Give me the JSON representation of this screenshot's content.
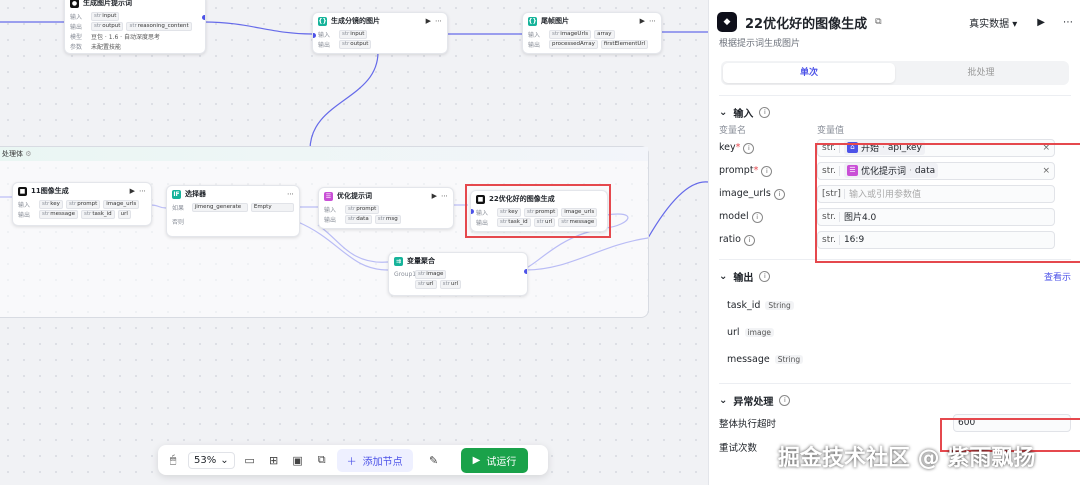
{
  "canvas": {
    "top_node_left": {
      "title": "生成图片提示词",
      "input_label": "输入",
      "output_label": "输出",
      "model_label": "模型",
      "param_label": "参数",
      "input_tag": "input",
      "output_tags": [
        "output",
        "reasoning_content"
      ],
      "model_value": "豆包 · 1.6 · 自动深度思考",
      "param_value": "未配置技能"
    },
    "node_split": {
      "title": "生成分镜的图片",
      "input_label": "输入",
      "output_label": "输出",
      "input_tag": "input",
      "output_tag": "output"
    },
    "node_tail": {
      "title": "尾帧图片",
      "input_label": "输入",
      "output_label": "输出",
      "input_tags": [
        "imageUrls",
        "array"
      ],
      "output_tags": [
        "processedArray",
        "firstElementUrl"
      ]
    },
    "group_title": "处理体",
    "node_11": {
      "title": "11图像生成",
      "input_label": "输入",
      "output_label": "输出",
      "input_tags": [
        "key",
        "prompt",
        "image_urls"
      ],
      "output_tags": [
        "message",
        "task_id",
        "url"
      ]
    },
    "node_selector": {
      "title": "选择器",
      "if_label": "如果",
      "else_label": "否则",
      "condition_value": "jimeng_generate",
      "condition_op": "Empty"
    },
    "node_optimize": {
      "title": "优化提示词",
      "input_label": "输入",
      "output_label": "输出",
      "input_tag": "prompt",
      "output_tags": [
        "data",
        "msg"
      ]
    },
    "node_22": {
      "title": "22优化好的图像生成",
      "input_label": "输入",
      "output_label": "输出",
      "input_tags": [
        "key",
        "prompt",
        "image_urls"
      ],
      "output_tags": [
        "task_id",
        "url",
        "message"
      ]
    },
    "node_merge": {
      "title": "变量聚合",
      "group_label": "Group1",
      "tags": [
        "image",
        "url",
        "url"
      ]
    }
  },
  "toolbar": {
    "zoom": "53%",
    "add_node": "添加节点",
    "run": "试运行"
  },
  "panel": {
    "title": "22优化好的图像生成",
    "data_mode": "真实数据",
    "subtitle": "根据提示词生成图片",
    "tabs": [
      "单次",
      "批处理"
    ],
    "input_section": "输入",
    "col_name": "变量名",
    "col_value": "变量值",
    "inputs": [
      {
        "name": "key",
        "required": "*",
        "type": "str.",
        "ref_node": "开始",
        "ref_var": "api_key"
      },
      {
        "name": "prompt",
        "required": "*",
        "type": "str.",
        "ref_node": "优化提示词",
        "ref_var": "data"
      },
      {
        "name": "image_urls",
        "required": "",
        "type": "[str]",
        "placeholder": "输入或引用参数值"
      },
      {
        "name": "model",
        "required": "",
        "type": "str.",
        "value": "图片4.0"
      },
      {
        "name": "ratio",
        "required": "",
        "type": "str.",
        "value": "16:9"
      }
    ],
    "output_section": "输出",
    "output_link": "查看示",
    "outputs": [
      {
        "name": "task_id",
        "type": "String"
      },
      {
        "name": "url",
        "type": "image"
      },
      {
        "name": "message",
        "type": "String"
      }
    ],
    "exception_section": "异常处理",
    "timeout_label": "整体执行超时",
    "timeout_value": "600",
    "retry_label": "重试次数"
  },
  "watermark": "掘金技术社区 @ 紫雨飘扬",
  "colors": {
    "accent": "#4d53e8",
    "run_green": "#1aa24a",
    "highlight_red": "#e5484d"
  }
}
